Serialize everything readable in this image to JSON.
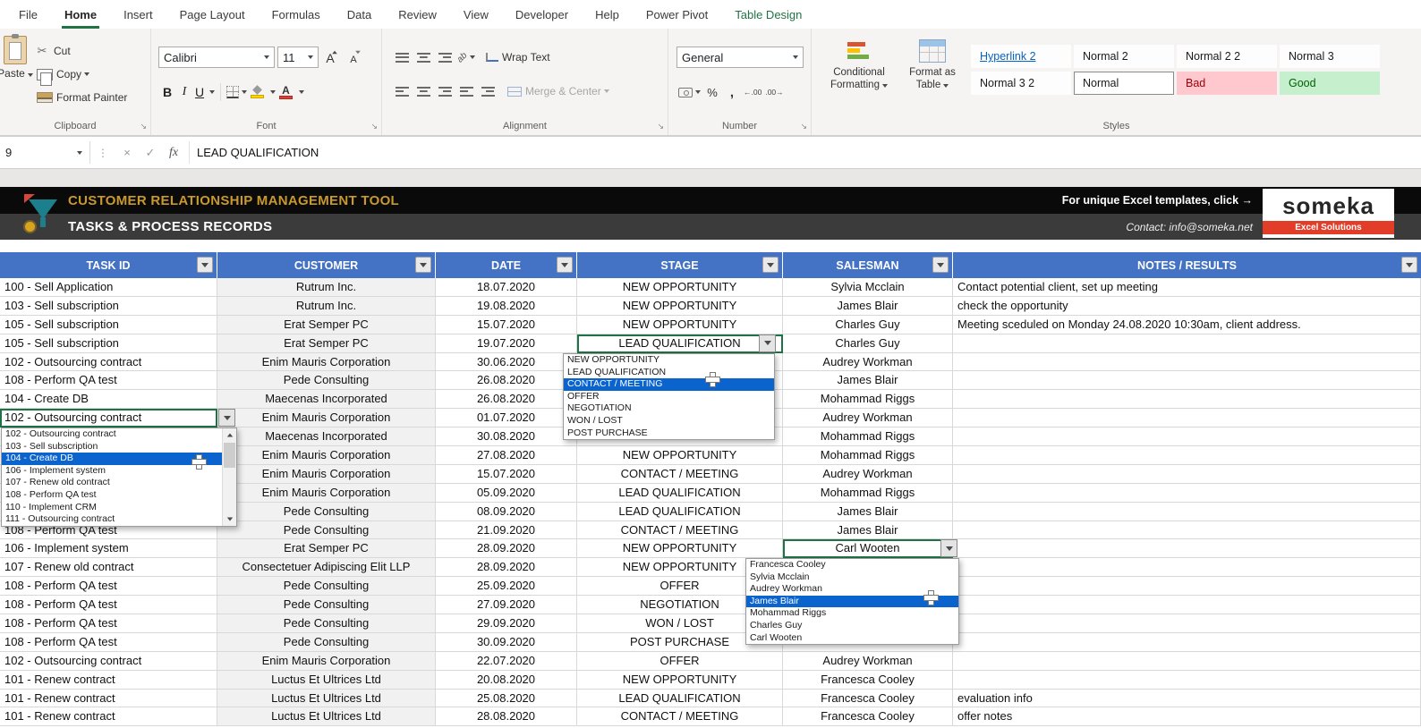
{
  "ribbon": {
    "tabs": [
      {
        "label": "File"
      },
      {
        "label": "Home",
        "active": true
      },
      {
        "label": "Insert"
      },
      {
        "label": "Page Layout"
      },
      {
        "label": "Formulas"
      },
      {
        "label": "Data"
      },
      {
        "label": "Review"
      },
      {
        "label": "View"
      },
      {
        "label": "Developer"
      },
      {
        "label": "Help"
      },
      {
        "label": "Power Pivot"
      },
      {
        "label": "Table Design",
        "contextual": true
      }
    ],
    "clipboard": {
      "label": "Clipboard",
      "paste": "Paste",
      "cut": "Cut",
      "copy": "Copy",
      "format_painter": "Format Painter"
    },
    "font": {
      "label": "Font",
      "family": "Calibri",
      "size": "11",
      "bold": "B",
      "italic": "I",
      "underline": "U",
      "grow": "A",
      "shrink": "A",
      "color_letter": "A"
    },
    "alignment": {
      "label": "Alignment",
      "wrap_text": "Wrap Text",
      "merge_center": "Merge & Center"
    },
    "number": {
      "label": "Number",
      "format": "General",
      "percent": "%",
      "comma": ","
    },
    "styles": {
      "label": "Styles",
      "conditional_line1": "Conditional",
      "conditional_line2": "Formatting",
      "format_table_line1": "Format as",
      "format_table_line2": "Table",
      "gallery": [
        {
          "label": "Hyperlink 2",
          "kind": "hyperlink"
        },
        {
          "label": "Normal 2"
        },
        {
          "label": "Normal 2 2"
        },
        {
          "label": "Normal 3"
        },
        {
          "label": "Normal 3 2"
        },
        {
          "label": "Normal",
          "selected": true
        },
        {
          "label": "Bad",
          "kind": "bad"
        },
        {
          "label": "Good",
          "kind": "good"
        }
      ]
    }
  },
  "formula_bar": {
    "name_box": "9",
    "fx": "fx",
    "value": "LEAD QUALIFICATION"
  },
  "banner": {
    "title": "CUSTOMER RELATIONSHIP MANAGEMENT TOOL",
    "subtitle": "TASKS & PROCESS RECORDS",
    "promo": "For unique Excel templates, click →",
    "contact": "Contact: info@someka.net",
    "logo_text": "someka",
    "logo_sub": "Excel Solutions"
  },
  "table": {
    "headers": [
      "TASK ID",
      "CUSTOMER",
      "DATE",
      "STAGE",
      "SALESMAN",
      "NOTES / RESULTS"
    ],
    "rows": [
      {
        "task": "100 - Sell Application",
        "customer": "Rutrum Inc.",
        "date": "18.07.2020",
        "stage": "NEW OPPORTUNITY",
        "salesman": "Sylvia Mcclain",
        "notes": "Contact potential client, set up meeting"
      },
      {
        "task": "103 - Sell subscription",
        "customer": "Rutrum Inc.",
        "date": "19.08.2020",
        "stage": "NEW OPPORTUNITY",
        "salesman": "James Blair",
        "notes": "check the opportunity"
      },
      {
        "task": "105 - Sell subscription",
        "customer": "Erat Semper PC",
        "date": "15.07.2020",
        "stage": "NEW OPPORTUNITY",
        "salesman": "Charles Guy",
        "notes": "Meeting sceduled on Monday 24.08.2020 10:30am, client address."
      },
      {
        "task": "105 - Sell subscription",
        "customer": "Erat Semper PC",
        "date": "19.07.2020",
        "stage": "LEAD QUALIFICATION",
        "salesman": "Charles Guy",
        "notes": "",
        "sel": "stage"
      },
      {
        "task": "102 - Outsourcing contract",
        "customer": "Enim Mauris Corporation",
        "date": "30.06.2020",
        "stage": "",
        "salesman": "Audrey Workman",
        "notes": ""
      },
      {
        "task": "108 - Perform QA test",
        "customer": "Pede Consulting",
        "date": "26.08.2020",
        "stage": "",
        "salesman": "James Blair",
        "notes": ""
      },
      {
        "task": "104 - Create DB",
        "customer": "Maecenas Incorporated",
        "date": "26.08.2020",
        "stage": "",
        "salesman": "Mohammad Riggs",
        "notes": ""
      },
      {
        "task": "102 - Outsourcing contract",
        "customer": "Enim Mauris Corporation",
        "date": "01.07.2020",
        "stage": "",
        "salesman": "Audrey Workman",
        "notes": "",
        "sel": "task"
      },
      {
        "task": "",
        "customer": "Maecenas Incorporated",
        "date": "30.08.2020",
        "stage": "",
        "salesman": "Mohammad Riggs",
        "notes": ""
      },
      {
        "task": "",
        "customer": "Enim Mauris Corporation",
        "date": "27.08.2020",
        "stage": "NEW OPPORTUNITY",
        "salesman": "Mohammad Riggs",
        "notes": ""
      },
      {
        "task": "",
        "customer": "Enim Mauris Corporation",
        "date": "15.07.2020",
        "stage": "CONTACT / MEETING",
        "salesman": "Audrey Workman",
        "notes": ""
      },
      {
        "task": "",
        "customer": "Enim Mauris Corporation",
        "date": "05.09.2020",
        "stage": "LEAD QUALIFICATION",
        "salesman": "Mohammad Riggs",
        "notes": ""
      },
      {
        "task": "",
        "customer": "Pede Consulting",
        "date": "08.09.2020",
        "stage": "LEAD QUALIFICATION",
        "salesman": "James Blair",
        "notes": ""
      },
      {
        "task": "108 - Perform QA test",
        "customer": "Pede Consulting",
        "date": "21.09.2020",
        "stage": "CONTACT / MEETING",
        "salesman": "James Blair",
        "notes": ""
      },
      {
        "task": "106 - Implement system",
        "customer": "Erat Semper PC",
        "date": "28.09.2020",
        "stage": "NEW OPPORTUNITY",
        "salesman": "Carl Wooten",
        "notes": "",
        "sel": "salesman"
      },
      {
        "task": "107 - Renew old contract",
        "customer": "Consectetuer Adipiscing Elit LLP",
        "date": "28.09.2020",
        "stage": "NEW OPPORTUNITY",
        "salesman": "",
        "notes": ""
      },
      {
        "task": "108 - Perform QA test",
        "customer": "Pede Consulting",
        "date": "25.09.2020",
        "stage": "OFFER",
        "salesman": "",
        "notes": ""
      },
      {
        "task": "108 - Perform QA test",
        "customer": "Pede Consulting",
        "date": "27.09.2020",
        "stage": "NEGOTIATION",
        "salesman": "",
        "notes": ""
      },
      {
        "task": "108 - Perform QA test",
        "customer": "Pede Consulting",
        "date": "29.09.2020",
        "stage": "WON / LOST",
        "salesman": "",
        "notes": ""
      },
      {
        "task": "108 - Perform QA test",
        "customer": "Pede Consulting",
        "date": "30.09.2020",
        "stage": "POST PURCHASE",
        "salesman": "",
        "notes": ""
      },
      {
        "task": "102 - Outsourcing contract",
        "customer": "Enim Mauris Corporation",
        "date": "22.07.2020",
        "stage": "OFFER",
        "salesman": "Audrey Workman",
        "notes": ""
      },
      {
        "task": "101 - Renew contract",
        "customer": "Luctus Et Ultrices Ltd",
        "date": "20.08.2020",
        "stage": "NEW OPPORTUNITY",
        "salesman": "Francesca Cooley",
        "notes": ""
      },
      {
        "task": "101 - Renew contract",
        "customer": "Luctus Et Ultrices Ltd",
        "date": "25.08.2020",
        "stage": "LEAD QUALIFICATION",
        "salesman": "Francesca Cooley",
        "notes": "evaluation info"
      },
      {
        "task": "101 - Renew contract",
        "customer": "Luctus Et Ultrices Ltd",
        "date": "28.08.2020",
        "stage": "CONTACT / MEETING",
        "salesman": "Francesca Cooley",
        "notes": "offer notes"
      }
    ]
  },
  "dropdowns": {
    "stage": {
      "items": [
        "NEW OPPORTUNITY",
        "LEAD QUALIFICATION",
        "CONTACT / MEETING",
        "OFFER",
        "NEGOTIATION",
        "WON / LOST",
        "POST PURCHASE"
      ],
      "selected": "CONTACT / MEETING"
    },
    "task": {
      "items": [
        "102 - Outsourcing contract",
        "103 - Sell subscription",
        "104 - Create DB",
        "106 - Implement system",
        "107 - Renew old contract",
        "108 - Perform QA test",
        "110 - Implement CRM",
        "111 - Outsourcing contract"
      ],
      "selected": "104 - Create DB"
    },
    "salesman": {
      "items": [
        "Francesca Cooley",
        "Sylvia Mcclain",
        "Audrey Workman",
        "James Blair",
        "Mohammad Riggs",
        "Charles Guy",
        "Carl Wooten"
      ],
      "selected": "James Blair"
    }
  },
  "icons": {
    "scissors": "✂",
    "launcher": "↘",
    "cancel": "×",
    "enter": "✓",
    "handle": "⋮",
    "orientation": "ab",
    "increase_decimal": "←.00",
    "decrease_decimal": ".00→"
  },
  "colors": {
    "header_blue": "#4472c4",
    "accent_green": "#1f7246",
    "selection_blue": "#0b63ce",
    "banner_gold": "#c9992c",
    "bad_bg": "#ffc7ce",
    "bad_text": "#9c0006",
    "good_bg": "#c6efce",
    "good_text": "#006100",
    "hyperlink": "#0563c1",
    "logo_red": "#e23d28"
  }
}
